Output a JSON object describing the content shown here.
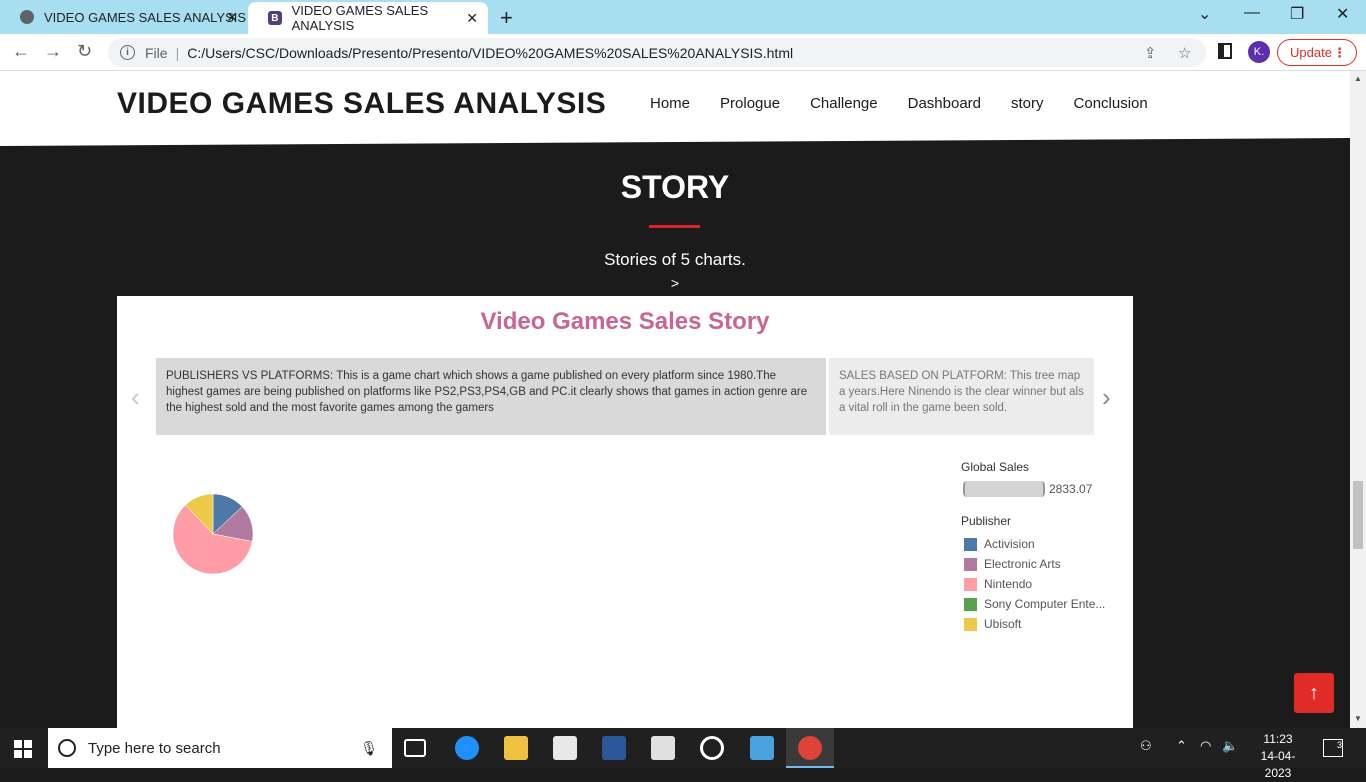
{
  "browser": {
    "tabs": [
      {
        "title": "VIDEO GAMES SALES ANALYSIS",
        "favicon": "globe-icon"
      },
      {
        "title": "VIDEO GAMES SALES ANALYSIS",
        "favicon": "bootstrap-icon",
        "favicon_letter": "B"
      }
    ],
    "address": {
      "scheme_label": "File",
      "url": "C:/Users/CSC/Downloads/Presento/Presento/VIDEO%20GAMES%20SALES%20ANALYSIS.html"
    },
    "profile_initial": "K.",
    "update_label": "Update"
  },
  "site": {
    "brand": "VIDEO GAMES SALES ANALYSIS",
    "nav": [
      "Home",
      "Prologue",
      "Challenge",
      "Dashboard",
      "story",
      "Conclusion"
    ]
  },
  "section": {
    "title": "STORY",
    "subtitle": "Stories of 5 charts.",
    "arrow": ">",
    "accent": "#d9232d"
  },
  "tableau": {
    "title": "Video Games Sales Story",
    "title_color": "#c96591",
    "cards": [
      {
        "text": "PUBLISHERS VS PLATFORMS: This is a game chart which shows a game published on every platform since 1980.The highest games are being published on platforms like PS2,PS3,PS4,GB and PC.it clearly shows that games in action genre are the highest sold and the most favorite games among the gamers"
      },
      {
        "text": "SALES BASED ON PLATFORM: This tree map a years.Here Ninendo is the clear winner but als a vital roll in the game been sold."
      }
    ],
    "legend": {
      "size_header": "Global Sales",
      "size_value": "2833.07",
      "color_header": "Publisher",
      "items": [
        {
          "label": "Activision",
          "color": "#4e79a7"
        },
        {
          "label": "Electronic Arts",
          "color": "#b07aa1"
        },
        {
          "label": "Nintendo",
          "color": "#ff9da7"
        },
        {
          "label": "Sony Computer Ente...",
          "color": "#59a14f"
        },
        {
          "label": "Ubisoft",
          "color": "#edc948"
        }
      ]
    }
  },
  "chart_data": {
    "type": "pie",
    "title": "",
    "categories": [
      "Activision",
      "Electronic Arts",
      "Nintendo",
      "Ubisoft"
    ],
    "values": [
      13,
      15,
      60,
      12
    ],
    "colors": [
      "#4e79a7",
      "#b07aa1",
      "#ff9da7",
      "#edc948"
    ]
  },
  "taskbar": {
    "search_placeholder": "Type here to search",
    "time": "11:23",
    "date": "14-04-2023",
    "notification_count": "3"
  }
}
